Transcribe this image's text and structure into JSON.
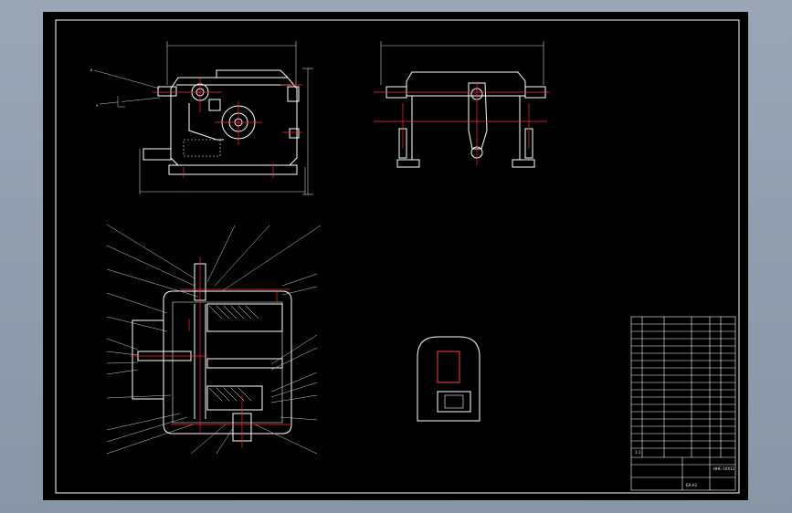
{
  "drawing": {
    "title_block": {
      "part_name": "HHC-10X12",
      "code": "EA-A3",
      "scale_row": "1:1"
    },
    "colors": {
      "background": "#000000",
      "frame": "#ffffff",
      "outline": "#ffffff",
      "centerline": "#ff2a2a",
      "hatch": "#ffffff",
      "leader": "#d0d0d0",
      "dim": "#cfcfcf"
    }
  }
}
